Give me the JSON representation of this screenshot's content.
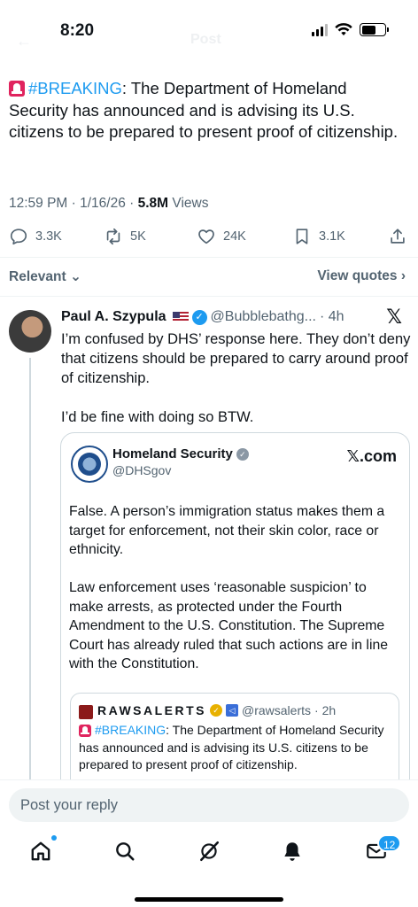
{
  "status_bar": {
    "time": "8:20"
  },
  "header": {
    "back_ghost": "←",
    "title_ghost": "Post"
  },
  "main_tweet": {
    "hashtag": "#BREAKING",
    "text": ": The Department of Homeland Security has announced and is advising its U.S. citizens to be prepared to present proof of citizenship.",
    "time": "12:59 PM · 1/16/26 · ",
    "views_count": "5.8M",
    "views_label": " Views",
    "replies": "3.3K",
    "reposts": "5K",
    "likes": "24K",
    "bookmarks": "3.1K"
  },
  "sort_bar": {
    "relevant": "Relevant",
    "view_quotes": "View quotes"
  },
  "reply": {
    "name": "Paul A. Szypula",
    "handle": "@Bubblebathg...",
    "time": "· 4h",
    "paragraph1": "I’m confused by DHS’ response here. They don’t deny that citizens should be prepared to carry around proof of citizenship.",
    "paragraph2": "I’d be fine with doing so BTW."
  },
  "quote": {
    "name": "Homeland Security",
    "handle": "@DHSgov",
    "site": "𝕏.com",
    "paragraph1": "False. A person’s immigration status makes them a target for enforcement, not their skin color, race or ethnicity.",
    "paragraph2": "Law enforcement uses ‘reasonable suspicion’ to make arrests, as protected under the Fourth Amendment to the U.S. Constitution. The Supreme Court has already ruled that such actions are in line with the Constitution."
  },
  "inner_quote": {
    "name": "RAWSALERTS",
    "handle": "@rawsalerts",
    "time": "· 2h",
    "hashtag": "#BREAKING",
    "text": ": The Department of Homeland Security has announced and is advising its U.S. citizens to be prepared to present proof of citizenship."
  },
  "composer": {
    "placeholder": "Post your reply"
  },
  "tab_bar": {
    "messages_badge": "12"
  },
  "colors": {
    "accent": "#1d9bf0",
    "muted": "#536471",
    "text": "#0f1419"
  }
}
